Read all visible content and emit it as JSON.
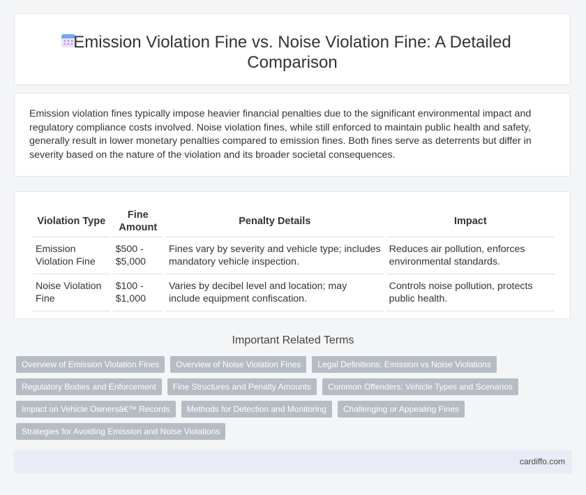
{
  "header": {
    "title": "Emission Violation Fine vs. Noise Violation Fine: A Detailed Comparison",
    "icon": "calendar-icon"
  },
  "intro": {
    "text": "Emission violation fines typically impose heavier financial penalties due to the significant environmental impact and regulatory compliance costs involved. Noise violation fines, while still enforced to maintain public health and safety, generally result in lower monetary penalties compared to emission fines. Both fines serve as deterrents but differ in severity based on the nature of the violation and its broader societal consequences."
  },
  "table": {
    "headers": [
      "Violation Type",
      "Fine Amount",
      "Penalty Details",
      "Impact"
    ],
    "rows": [
      [
        "Emission Violation Fine",
        "$500 - $5,000",
        "Fines vary by severity and vehicle type; includes mandatory vehicle inspection.",
        "Reduces air pollution, enforces environmental standards."
      ],
      [
        "Noise Violation Fine",
        "$100 - $1,000",
        "Varies by decibel level and location; may include equipment confiscation.",
        "Controls noise pollution, protects public health."
      ]
    ]
  },
  "related": {
    "heading": "Important Related Terms",
    "terms": [
      "Overview of Emission Violation Fines",
      "Overview of Noise Violation Fines",
      "Legal Definitions: Emission vs Noise Violations",
      "Regulatory Bodies and Enforcement",
      "Fine Structures and Penalty Amounts",
      "Common Offenders: Vehicle Types and Scenarios",
      "Impact on Vehicle Ownersâ€™ Records",
      "Methods for Detection and Monitoring",
      "Challenging or Appealing Fines",
      "Strategies for Avoiding Emission and Noise Violations"
    ]
  },
  "footer": {
    "site": "cardiffo.com"
  }
}
